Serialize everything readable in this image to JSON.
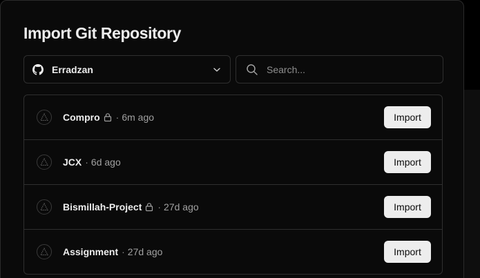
{
  "dialog": {
    "title": "Import Git Repository"
  },
  "scope": {
    "account": "Erradzan",
    "provider_icon": "github-icon"
  },
  "search": {
    "placeholder": "Search...",
    "value": ""
  },
  "repos": [
    {
      "name": "Compro",
      "private": true,
      "separator": "·",
      "updated": "6m ago",
      "action": "Import"
    },
    {
      "name": "JCX",
      "private": false,
      "separator": "·",
      "updated": "6d ago",
      "action": "Import"
    },
    {
      "name": "Bismillah-Project",
      "private": true,
      "separator": "·",
      "updated": "27d ago",
      "action": "Import"
    },
    {
      "name": "Assignment",
      "private": false,
      "separator": "·",
      "updated": "27d ago",
      "action": "Import"
    }
  ],
  "colors": {
    "background": "#000000",
    "panel": "#0a0a0a",
    "border": "#2f2f2f",
    "text": "#ededed",
    "muted": "#a1a1a1",
    "button_bg": "#ededed",
    "button_text": "#0a0a0a"
  }
}
